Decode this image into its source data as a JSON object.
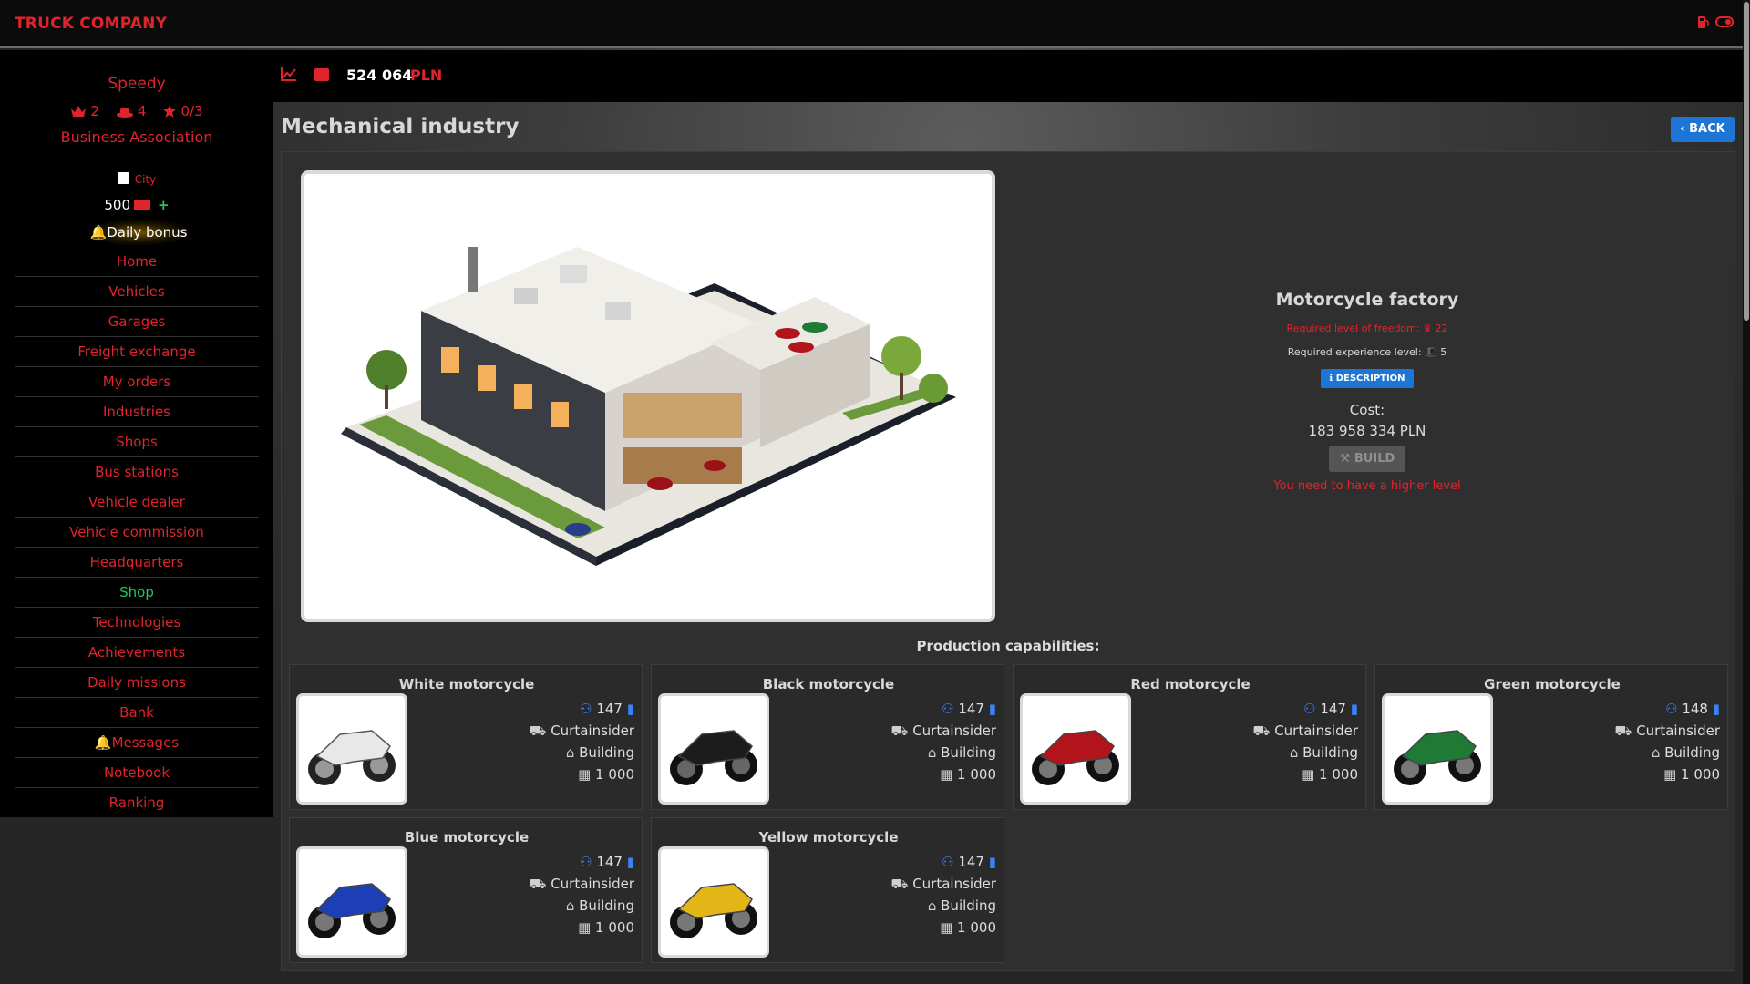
{
  "app": {
    "title": "TRUCK COMPANY"
  },
  "user": {
    "name": "Speedy",
    "freedom_level": "2",
    "experience_level": "4",
    "stars": "0/3",
    "association": "Business Association",
    "city_label": "City",
    "money_small": "500",
    "daily_bonus": "Daily bonus"
  },
  "nav": [
    {
      "label": "Home",
      "green": false
    },
    {
      "label": "Vehicles",
      "green": false
    },
    {
      "label": "Garages",
      "green": false
    },
    {
      "label": "Freight exchange",
      "green": false
    },
    {
      "label": "My orders",
      "green": false
    },
    {
      "label": "Industries",
      "green": false
    },
    {
      "label": "Shops",
      "green": false
    },
    {
      "label": "Bus stations",
      "green": false
    },
    {
      "label": "Vehicle dealer",
      "green": false
    },
    {
      "label": "Vehicle commission",
      "green": false
    },
    {
      "label": "Headquarters",
      "green": false
    },
    {
      "label": "Shop",
      "green": true
    },
    {
      "label": "Technologies",
      "green": false
    },
    {
      "label": "Achievements",
      "green": false
    },
    {
      "label": "Daily missions",
      "green": false
    },
    {
      "label": "Bank",
      "green": false
    },
    {
      "label": "Messages",
      "green": false,
      "bell": true
    },
    {
      "label": "Notebook",
      "green": false
    },
    {
      "label": "Ranking",
      "green": false
    }
  ],
  "header": {
    "balance": "524 064",
    "currency": "PLN"
  },
  "page": {
    "title": "Mechanical industry",
    "back_label": "BACK"
  },
  "factory": {
    "name": "Motorcycle factory",
    "required_freedom_label": "Required level of freedom:",
    "required_freedom_value": "22",
    "required_experience_label": "Required experience level:",
    "required_experience_value": "5",
    "description_label": "DESCRIPTION",
    "cost_label": "Cost:",
    "cost_value": "183 958 334  PLN",
    "build_label": "BUILD",
    "warning": "You need to have a higher level"
  },
  "production": {
    "title": "Production capabilities:",
    "items": [
      {
        "name": "White motorcycle",
        "value": "147",
        "trailer": "Curtainsider",
        "place": "Building",
        "qty": "1 000",
        "color": "#e8e8e8"
      },
      {
        "name": "Black motorcycle",
        "value": "147",
        "trailer": "Curtainsider",
        "place": "Building",
        "qty": "1 000",
        "color": "#1c1c1c"
      },
      {
        "name": "Red motorcycle",
        "value": "147",
        "trailer": "Curtainsider",
        "place": "Building",
        "qty": "1 000",
        "color": "#b3141c"
      },
      {
        "name": "Green motorcycle",
        "value": "148",
        "trailer": "Curtainsider",
        "place": "Building",
        "qty": "1 000",
        "color": "#1f7a35"
      },
      {
        "name": "Blue motorcycle",
        "value": "147",
        "trailer": "Curtainsider",
        "place": "Building",
        "qty": "1 000",
        "color": "#1c3fb8"
      },
      {
        "name": "Yellow motorcycle",
        "value": "147",
        "trailer": "Curtainsider",
        "place": "Building",
        "qty": "1 000",
        "color": "#e3b618"
      }
    ]
  },
  "colors": {
    "accent_red": "#e0242c",
    "button_blue": "#1d76d6",
    "green": "#22c55e"
  }
}
